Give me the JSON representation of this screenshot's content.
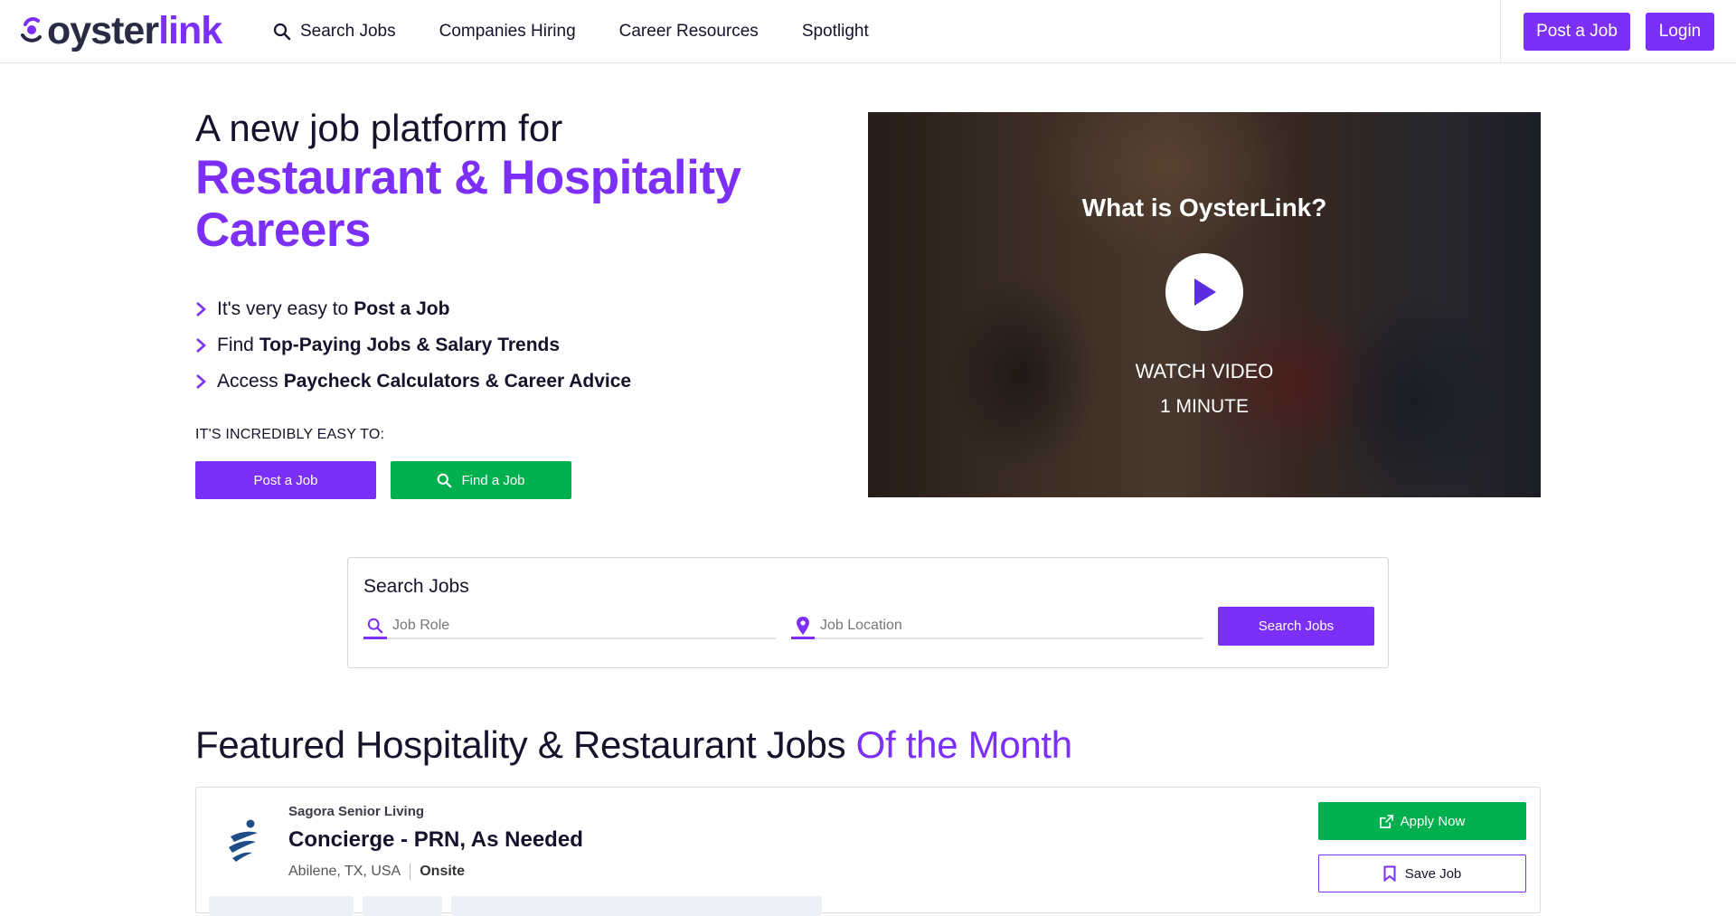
{
  "header": {
    "logo_left": "oyster",
    "logo_right": "link",
    "nav": [
      {
        "label": "Search Jobs",
        "icon": "search-icon"
      },
      {
        "label": "Companies Hiring"
      },
      {
        "label": "Career Resources"
      },
      {
        "label": "Spotlight"
      }
    ],
    "post_job_label": "Post a Job",
    "login_label": "Login"
  },
  "hero": {
    "line1": "A new job platform for",
    "line2": "Restaurant & Hospitality Careers",
    "bullets": [
      {
        "prefix": "It's very easy to",
        "bold": "Post a Job"
      },
      {
        "prefix": "Find",
        "bold": "Top-Paying Jobs & Salary Trends"
      },
      {
        "prefix": "Access",
        "bold": "Paycheck Calculators & Career Advice"
      }
    ],
    "easy_label": "IT'S INCREDIBLY EASY TO:",
    "post_button": "Post a Job",
    "find_button": "Find a Job"
  },
  "video": {
    "title": "What is OysterLink?",
    "watch": "WATCH VIDEO",
    "duration": "1 MINUTE"
  },
  "search": {
    "title": "Search Jobs",
    "role_placeholder": "Job Role",
    "location_placeholder": "Job Location",
    "submit_label": "Search Jobs"
  },
  "featured": {
    "title_main": "Featured Hospitality & Restaurant Jobs",
    "title_accent": "Of the Month",
    "jobs": [
      {
        "company": "Sagora Senior Living",
        "title": "Concierge - PRN, As Needed",
        "location": "Abilene, TX, USA",
        "work_type": "Onsite",
        "apply_label": "Apply Now",
        "save_label": "Save Job"
      }
    ]
  },
  "colors": {
    "accent": "#7b2ff7",
    "green": "#00b04f",
    "text": "#15122b"
  }
}
